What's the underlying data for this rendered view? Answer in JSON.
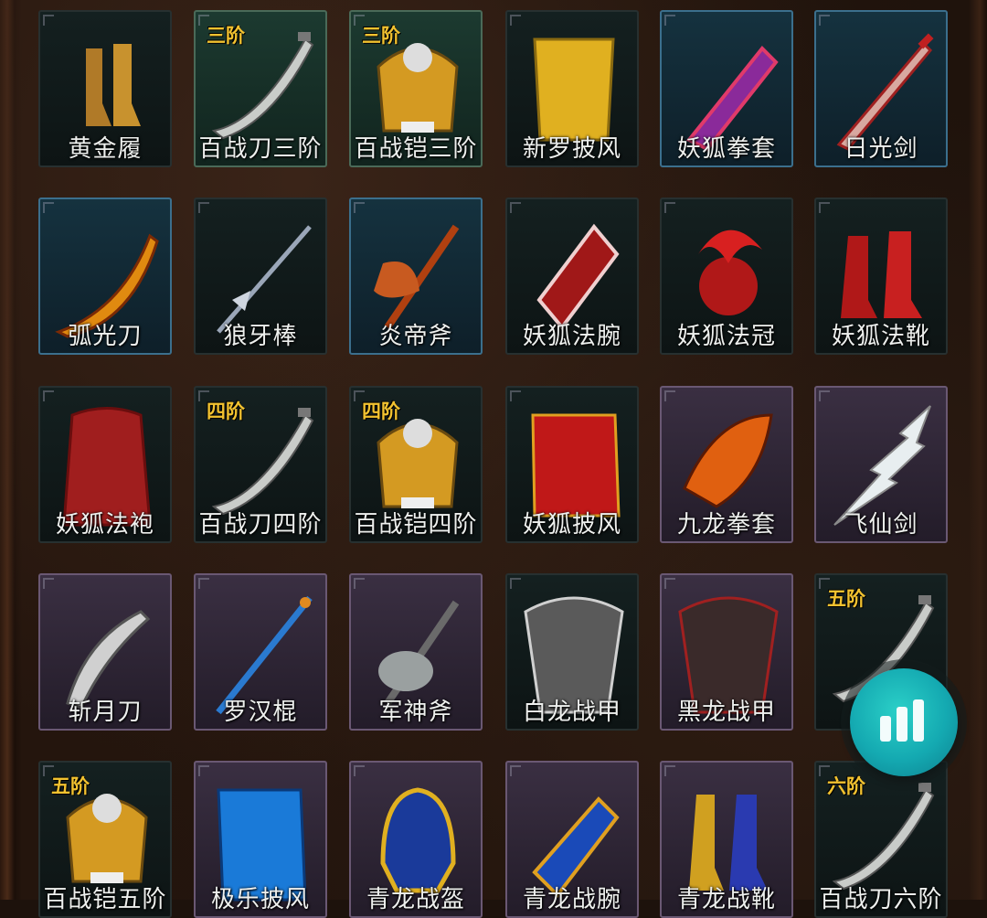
{
  "rows": [
    [
      {
        "name": "黄金履",
        "tier": "",
        "frame": "dark",
        "icon": "golden-boots-icon"
      },
      {
        "name": "百战刀三阶",
        "tier": "三阶",
        "frame": "green",
        "icon": "curved-blade-icon"
      },
      {
        "name": "百战铠三阶",
        "tier": "三阶",
        "frame": "green",
        "icon": "golden-armor-icon"
      },
      {
        "name": "新罗披风",
        "tier": "",
        "frame": "dark",
        "icon": "yellow-cape-icon"
      },
      {
        "name": "妖狐拳套",
        "tier": "",
        "frame": "blue",
        "icon": "purple-gauntlet-icon"
      },
      {
        "name": "日光剑",
        "tier": "",
        "frame": "blue",
        "icon": "red-sword-icon"
      }
    ],
    [
      {
        "name": "弧光刀",
        "tier": "",
        "frame": "blue",
        "icon": "flame-blade-icon"
      },
      {
        "name": "狼牙棒",
        "tier": "",
        "frame": "dark",
        "icon": "spear-icon"
      },
      {
        "name": "炎帝斧",
        "tier": "",
        "frame": "blue",
        "icon": "fire-axe-icon"
      },
      {
        "name": "妖狐法腕",
        "tier": "",
        "frame": "dark",
        "icon": "red-bracer-icon"
      },
      {
        "name": "妖狐法冠",
        "tier": "",
        "frame": "dark",
        "icon": "red-crown-icon"
      },
      {
        "name": "妖狐法靴",
        "tier": "",
        "frame": "dark",
        "icon": "red-boots-icon"
      }
    ],
    [
      {
        "name": "妖狐法袍",
        "tier": "",
        "frame": "dark",
        "icon": "red-robe-icon"
      },
      {
        "name": "百战刀四阶",
        "tier": "四阶",
        "frame": "dark",
        "icon": "curved-blade-icon"
      },
      {
        "name": "百战铠四阶",
        "tier": "四阶",
        "frame": "dark",
        "icon": "golden-armor-icon"
      },
      {
        "name": "妖狐披风",
        "tier": "",
        "frame": "dark",
        "icon": "red-cape-icon"
      },
      {
        "name": "九龙拳套",
        "tier": "",
        "frame": "purple",
        "icon": "dragon-gauntlet-icon"
      },
      {
        "name": "飞仙剑",
        "tier": "",
        "frame": "purple",
        "icon": "lightning-sword-icon"
      }
    ],
    [
      {
        "name": "斩月刀",
        "tier": "",
        "frame": "purple",
        "icon": "moon-blade-icon"
      },
      {
        "name": "罗汉棍",
        "tier": "",
        "frame": "purple",
        "icon": "blue-staff-icon"
      },
      {
        "name": "军神斧",
        "tier": "",
        "frame": "purple",
        "icon": "battle-axe-icon"
      },
      {
        "name": "白龙战甲",
        "tier": "",
        "frame": "dark",
        "icon": "white-dragon-armor-icon"
      },
      {
        "name": "黑龙战甲",
        "tier": "",
        "frame": "purple",
        "icon": "black-dragon-armor-icon"
      },
      {
        "name": "百",
        "tier": "五阶",
        "frame": "dark",
        "icon": "curved-blade-icon"
      }
    ],
    [
      {
        "name": "百战铠五阶",
        "tier": "五阶",
        "frame": "dark",
        "icon": "golden-armor-icon"
      },
      {
        "name": "极乐披风",
        "tier": "",
        "frame": "purple",
        "icon": "blue-cape-icon"
      },
      {
        "name": "青龙战盔",
        "tier": "",
        "frame": "purple",
        "icon": "blue-helmet-icon"
      },
      {
        "name": "青龙战腕",
        "tier": "",
        "frame": "purple",
        "icon": "blue-bracer-icon"
      },
      {
        "name": "青龙战靴",
        "tier": "",
        "frame": "purple",
        "icon": "blue-boots-icon"
      },
      {
        "name": "百战刀六阶",
        "tier": "六阶",
        "frame": "dark",
        "icon": "curved-blade-icon"
      }
    ]
  ],
  "floating_button": {
    "icon": "bar-chart-icon",
    "color": "#14a9b1"
  }
}
